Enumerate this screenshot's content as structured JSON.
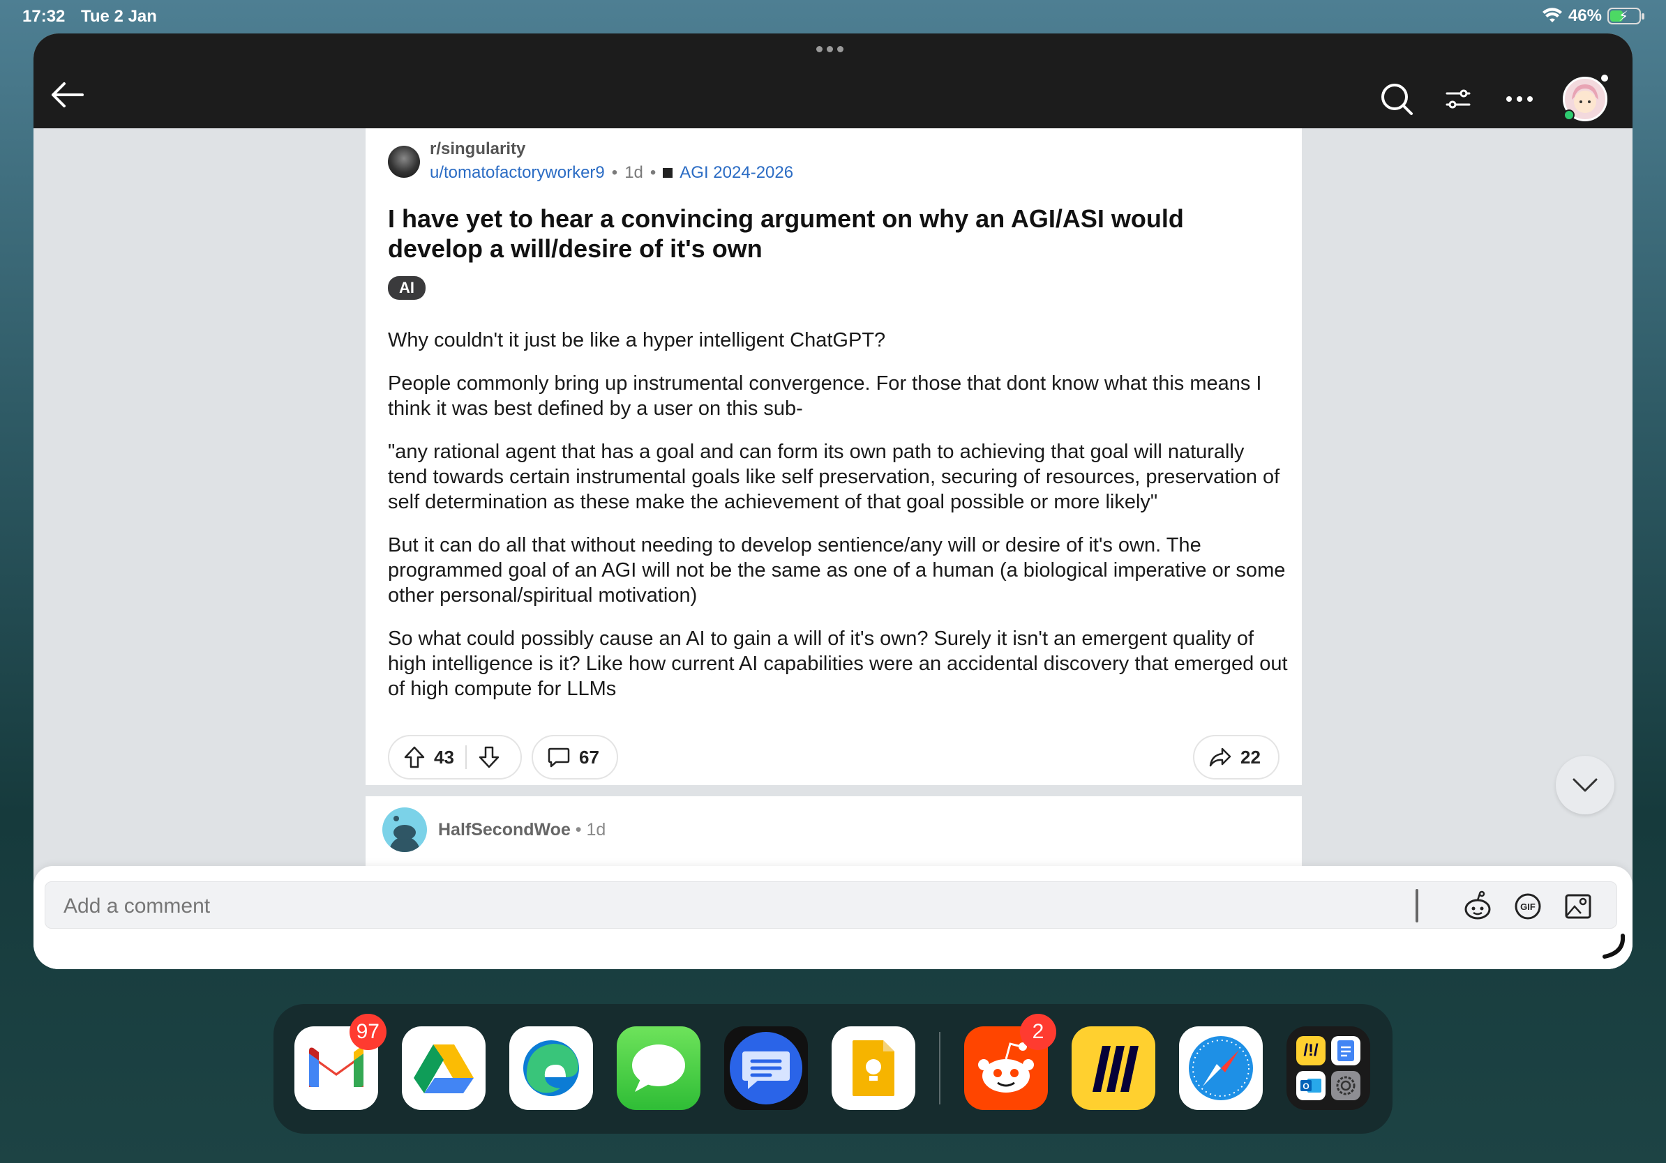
{
  "status_bar": {
    "time": "17:32",
    "date": "Tue 2 Jan",
    "battery": "46%",
    "battery_level": 0.46
  },
  "post": {
    "subreddit": "r/singularity",
    "author": "u/tomatofactoryworker9",
    "age": "1d",
    "flair": "AGI 2024-2026",
    "title": "I have yet to hear a convincing argument on why an AGI/ASI would develop a will/desire of it's own",
    "tag": "AI",
    "paragraphs": [
      "Why couldn't it just be like a hyper intelligent ChatGPT?",
      "People commonly bring up instrumental convergence. For those that dont know what this means I think it was best defined by a user on this sub-",
      "\"any rational agent that has a goal and can form its own path to achieving that goal will naturally tend towards certain instrumental goals like self preservation, securing of resources, preservation of self determination as these make the achievement of that goal possible or more likely\"",
      "But it can do all that without needing to develop sentience/any will or desire of it's own. The programmed goal of an AGI will not be the same as one of a human (a biological imperative or some other personal/spiritual motivation)",
      "So what could possibly cause an AI to gain a will of it's own? Surely it isn't an emergent quality of high intelligence is it? Like how current AI capabilities were an accidental discovery that emerged out of high compute for LLMs"
    ],
    "upvotes": "43",
    "comments": "67",
    "shares": "22"
  },
  "comment": {
    "user": "HalfSecondWoe",
    "age": "1d"
  },
  "composer": {
    "placeholder": "Add a comment"
  },
  "icons": {
    "back": "back-arrow-icon",
    "search": "search-icon",
    "sort": "sort-icon",
    "more": "more-icon",
    "upvote": "upvote-icon",
    "downvote": "downvote-icon",
    "comment": "comment-icon",
    "share": "share-icon",
    "scroll": "chevron-down-icon",
    "snoo": "snoo-icon",
    "gif": "gif-icon",
    "image": "image-icon"
  },
  "dock": {
    "apps": [
      {
        "name": "Gmail",
        "badge": "97"
      },
      {
        "name": "Google Drive"
      },
      {
        "name": "Microsoft Edge"
      },
      {
        "name": "Messages"
      },
      {
        "name": "Google Messages"
      },
      {
        "name": "Google Keep"
      },
      {
        "name": "Reddit",
        "badge": "2"
      },
      {
        "name": "Miro"
      },
      {
        "name": "Safari"
      },
      {
        "name": "App Folder"
      }
    ]
  },
  "colors": {
    "link": "#2b6cc4",
    "titlebar": "#1c1c1c",
    "badge": "#ff3b30"
  }
}
